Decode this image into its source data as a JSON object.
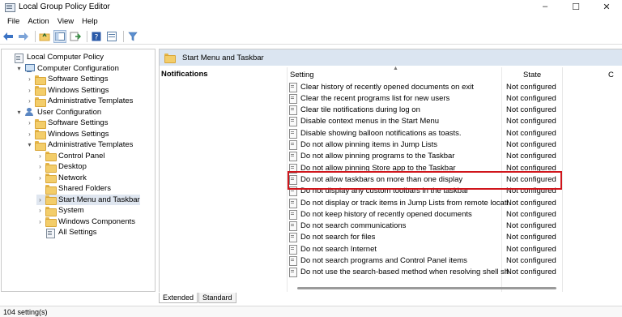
{
  "window": {
    "title": "Local Group Policy Editor",
    "minimize": "–",
    "maximize": "☐",
    "close": "✕"
  },
  "menu": [
    "File",
    "Action",
    "View",
    "Help"
  ],
  "tree": [
    {
      "label": "Local Computer Policy",
      "icon": "policy",
      "indent": 0,
      "expander": ""
    },
    {
      "label": "Computer Configuration",
      "icon": "computer",
      "indent": 1,
      "expander": "▾"
    },
    {
      "label": "Software Settings",
      "icon": "folder",
      "indent": 2,
      "expander": "›"
    },
    {
      "label": "Windows Settings",
      "icon": "folder",
      "indent": 2,
      "expander": "›"
    },
    {
      "label": "Administrative Templates",
      "icon": "folder",
      "indent": 2,
      "expander": "›"
    },
    {
      "label": "User Configuration",
      "icon": "user",
      "indent": 1,
      "expander": "▾"
    },
    {
      "label": "Software Settings",
      "icon": "folder",
      "indent": 2,
      "expander": "›"
    },
    {
      "label": "Windows Settings",
      "icon": "folder",
      "indent": 2,
      "expander": "›"
    },
    {
      "label": "Administrative Templates",
      "icon": "folder",
      "indent": 2,
      "expander": "▾"
    },
    {
      "label": "Control Panel",
      "icon": "folder",
      "indent": 3,
      "expander": "›"
    },
    {
      "label": "Desktop",
      "icon": "folder",
      "indent": 3,
      "expander": "›"
    },
    {
      "label": "Network",
      "icon": "folder",
      "indent": 3,
      "expander": "›"
    },
    {
      "label": "Shared Folders",
      "icon": "folder",
      "indent": 3,
      "expander": ""
    },
    {
      "label": "Start Menu and Taskbar",
      "icon": "folder",
      "indent": 3,
      "expander": "›",
      "selected": true
    },
    {
      "label": "System",
      "icon": "folder",
      "indent": 3,
      "expander": "›"
    },
    {
      "label": "Windows Components",
      "icon": "folder",
      "indent": 3,
      "expander": "›"
    },
    {
      "label": "All Settings",
      "icon": "policy",
      "indent": 3,
      "expander": ""
    }
  ],
  "right": {
    "header_title": "Start Menu and Taskbar",
    "description_title": "Notifications",
    "columns": {
      "setting": "Setting",
      "state": "State",
      "comment": "C"
    },
    "rows": [
      {
        "setting": "Clear history of recently opened documents on exit",
        "state": "Not configured"
      },
      {
        "setting": "Clear the recent programs list for new users",
        "state": "Not configured"
      },
      {
        "setting": "Clear tile notifications during log on",
        "state": "Not configured"
      },
      {
        "setting": "Disable context menus in the Start Menu",
        "state": "Not configured"
      },
      {
        "setting": "Disable showing balloon notifications as toasts.",
        "state": "Not configured"
      },
      {
        "setting": "Do not allow pinning items in Jump Lists",
        "state": "Not configured"
      },
      {
        "setting": "Do not allow pinning programs to the Taskbar",
        "state": "Not configured"
      },
      {
        "setting": "Do not allow pinning Store app to the Taskbar",
        "state": "Not configured"
      },
      {
        "setting": "Do not allow taskbars on more than one display",
        "state": "Not configured",
        "highlighted": true
      },
      {
        "setting": "Do not display any custom toolbars in the taskbar",
        "state": "Not configured"
      },
      {
        "setting": "Do not display or track items in Jump Lists from remote locati...",
        "state": "Not configured"
      },
      {
        "setting": "Do not keep history of recently opened documents",
        "state": "Not configured"
      },
      {
        "setting": "Do not search communications",
        "state": "Not configured"
      },
      {
        "setting": "Do not search for files",
        "state": "Not configured"
      },
      {
        "setting": "Do not search Internet",
        "state": "Not configured"
      },
      {
        "setting": "Do not search programs and Control Panel items",
        "state": "Not configured"
      },
      {
        "setting": "Do not use the search-based method when resolving shell sh...",
        "state": "Not configured"
      }
    ]
  },
  "tabs": [
    "Extended",
    "Standard"
  ],
  "status": "104 setting(s)",
  "colors": {
    "accent": "#dbe5f1",
    "highlight_border": "#d0151b",
    "selection": "#dfe6f0"
  }
}
